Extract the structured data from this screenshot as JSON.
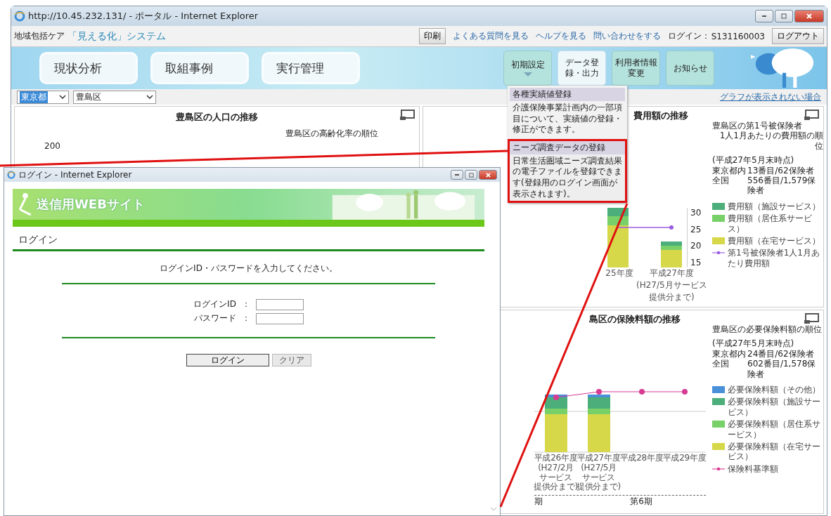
{
  "main_window": {
    "title": "http://10.45.232.131/ - ポータル - Internet Explorer"
  },
  "header": {
    "brand_small": "地域包括ケア",
    "brand": "「見える化」システム",
    "print_button": "印刷",
    "links": [
      "よくある質問を見る",
      "ヘルプを見る",
      "問い合わせをする"
    ],
    "login_label": "ログイン：",
    "login_id": "S131160003",
    "logout_button": "ログアウト"
  },
  "main_nav": [
    {
      "label": "現状分析"
    },
    {
      "label": "取組事例"
    },
    {
      "label": "実行管理"
    }
  ],
  "sub_nav": [
    {
      "label": "初期設定",
      "selected": false,
      "dropdown": true
    },
    {
      "label": "データ登録・出力",
      "selected": true,
      "dropdown": false
    },
    {
      "label": "利用者情報変更",
      "selected": false,
      "dropdown": false
    },
    {
      "label": "お知らせ",
      "selected": false,
      "dropdown": false
    }
  ],
  "dropdown_menu": [
    {
      "heading": "各種実績値登録",
      "description": "介護保険事業計画内の一部項目について、実績値の登録・修正ができます。",
      "highlighted": false
    },
    {
      "heading": "ニーズ調査データの登録",
      "description": "日常生活圏域ニーズ調査結果の電子ファイルを登録できます(登録用のログイン画面が表示されます)。",
      "highlighted": true
    }
  ],
  "filters": {
    "prefecture": "東京都",
    "municipality": "豊島区"
  },
  "graph_help_link": "グラフが表示されない場合",
  "population_panel": {
    "title": "豊島区の人口の推移",
    "ranking_title": "豊島区の高齢化率の順位",
    "y_tick": "200"
  },
  "cost_panel": {
    "title": "費用額の推移",
    "ranking_title": [
      "豊島区の第1号被保険者",
      "1人1月あたりの費用額の順位"
    ],
    "as_of": "(平成27年5月末時点)",
    "ranks": [
      {
        "scope": "東京都内",
        "rank": "13番目/62保険者"
      },
      {
        "scope": "全国",
        "rank": "556番目/1,579保険者"
      }
    ],
    "legend": [
      {
        "label": "費用額（施設サービス）",
        "color": "#4cae7a",
        "kind": "bar"
      },
      {
        "label": "費用額（居住系サービス）",
        "color": "#78d068",
        "kind": "bar"
      },
      {
        "label": "費用額（在宅サービス）",
        "color": "#d6d84a",
        "kind": "bar"
      },
      {
        "label": "第1号被保険者1人1月あたり費用額",
        "color": "#9a5ce0",
        "kind": "line"
      }
    ],
    "y_ticks": [
      "30",
      "25",
      "20",
      "15"
    ],
    "x_labels": [
      {
        "lines": [
          "25年度"
        ]
      },
      {
        "lines": [
          "平成27年度",
          "(H27/5月サービス",
          "提供分まで)"
        ]
      }
    ]
  },
  "premium_panel": {
    "title": "島区の保険料額の推移",
    "ranking_title": "豊島区の必要保険料額の順位",
    "as_of": "(平成27年5月末時点)",
    "ranks": [
      {
        "scope": "東京都内",
        "rank": "24番目/62保険者"
      },
      {
        "scope": "全国",
        "rank": "602番目/1,578保険者"
      }
    ],
    "legend": [
      {
        "label": "必要保険料額（その他）",
        "color": "#4a90d9",
        "kind": "bar"
      },
      {
        "label": "必要保険料額（施設サービス）",
        "color": "#4cae7a",
        "kind": "bar"
      },
      {
        "label": "必要保険料額（居住系サービス）",
        "color": "#78d068",
        "kind": "bar"
      },
      {
        "label": "必要保険料額（在宅サービス）",
        "color": "#d6d84a",
        "kind": "bar"
      },
      {
        "label": "保険料基準額",
        "color": "#d63c93",
        "kind": "line"
      }
    ],
    "x_labels": [
      {
        "lines": [
          "平成26年度",
          "(H27/2月",
          "サービス",
          "提供分まで)"
        ]
      },
      {
        "lines": [
          "平成27年度",
          "(H27/5月",
          "サービス",
          "提供分まで)"
        ]
      },
      {
        "lines": [
          "平成28年度"
        ]
      },
      {
        "lines": [
          "平成29年度"
        ]
      }
    ],
    "periods": [
      "期",
      "第6期"
    ]
  },
  "login_window": {
    "title": "ログイン - Internet Explorer",
    "site_title": "送信用WEBサイト",
    "heading": "ログイン",
    "instruction": "ログインID・パスワードを入力してください。",
    "fields": [
      {
        "label": "ログインID",
        "separator": "："
      },
      {
        "label": "パスワード",
        "separator": "："
      }
    ],
    "buttons": [
      {
        "label": "ログイン",
        "kind": "primary"
      },
      {
        "label": "クリア",
        "kind": "secondary"
      }
    ]
  }
}
